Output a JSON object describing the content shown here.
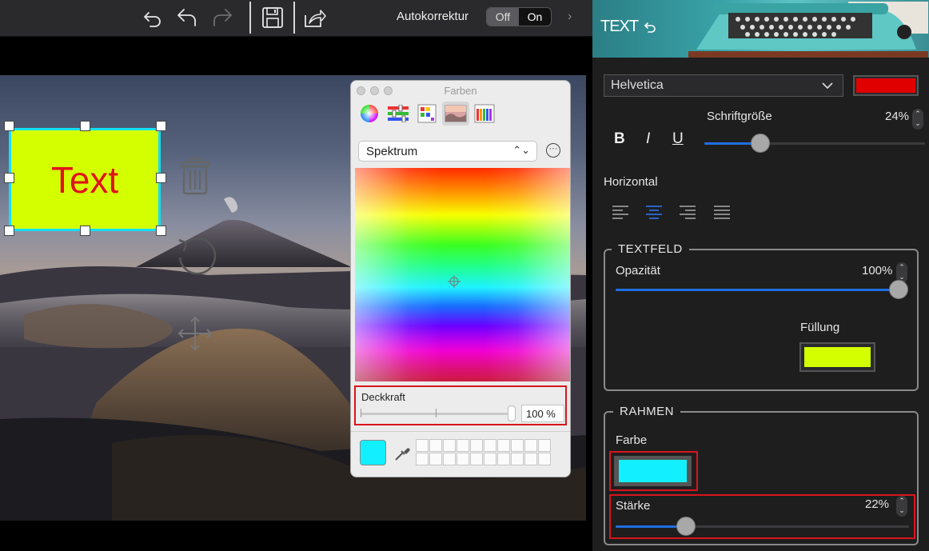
{
  "toolbar": {
    "autokorrektur_label": "Autokorrektur",
    "toggle_off": "Off",
    "toggle_on": "On",
    "selected": "Off"
  },
  "canvas": {
    "text_box": {
      "text": "Text",
      "fill_color": "#d4ff00",
      "text_color": "#e1121b",
      "border_color": "#12e0f5"
    }
  },
  "color_panel": {
    "title": "Farben",
    "mode_dropdown": "Spektrum",
    "opacity_label": "Deckkraft",
    "opacity_value": "100 %",
    "opacity_fraction": 1.0,
    "current_color": "#12f0ff"
  },
  "right_panel": {
    "header_title": "TEXT",
    "font_family": "Helvetica",
    "font_color": "#e00000",
    "font_size_label": "Schriftgröße",
    "font_size_value": "24%",
    "font_size_fraction": 0.24,
    "bold": "B",
    "italic": "I",
    "underline": "U",
    "horizontal_label": "Horizontal",
    "align_selected": "center",
    "textfeld": {
      "title": "TEXTFELD",
      "opacity_label": "Opazität",
      "opacity_value": "100%",
      "opacity_fraction": 1.0,
      "fill_label": "Füllung",
      "fill_color": "#d4ff00"
    },
    "rahmen": {
      "title": "RAHMEN",
      "color_label": "Farbe",
      "color": "#12f0ff",
      "strength_label": "Stärke",
      "strength_value": "22%",
      "strength_fraction": 0.22
    }
  }
}
